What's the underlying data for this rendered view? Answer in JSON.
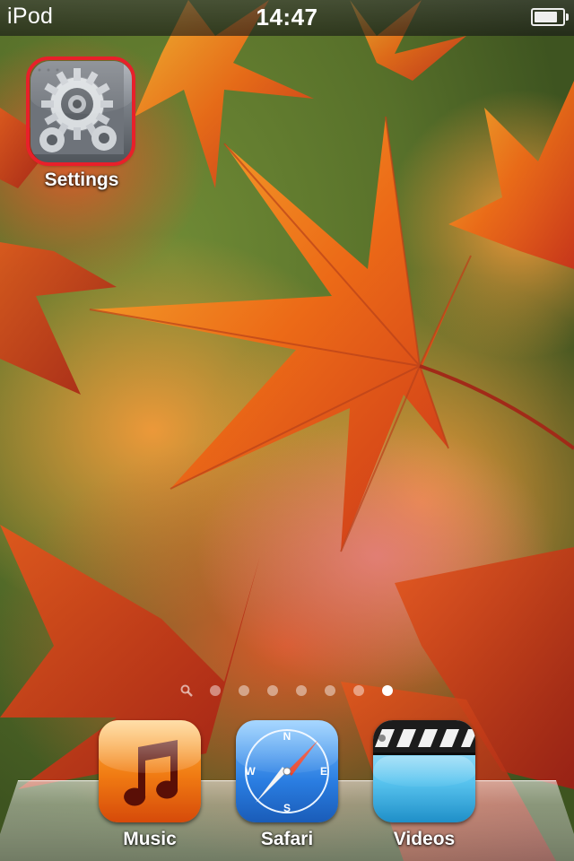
{
  "status_bar": {
    "carrier": "iPod",
    "time": "14:47",
    "battery_level": 0.9
  },
  "home": {
    "apps": [
      {
        "label": "Settings",
        "icon": "gear-icon",
        "highlighted": true
      }
    ]
  },
  "page_indicator": {
    "search_icon": "search-icon",
    "page_count": 7,
    "current_page": 7
  },
  "dock": {
    "apps": [
      {
        "label": "Music",
        "icon": "music-note-icon"
      },
      {
        "label": "Safari",
        "icon": "compass-icon"
      },
      {
        "label": "Videos",
        "icon": "clapperboard-icon"
      }
    ]
  },
  "colors": {
    "highlight": "#e8202a",
    "music_orange": "#f07a12",
    "safari_blue": "#2a7de1"
  }
}
